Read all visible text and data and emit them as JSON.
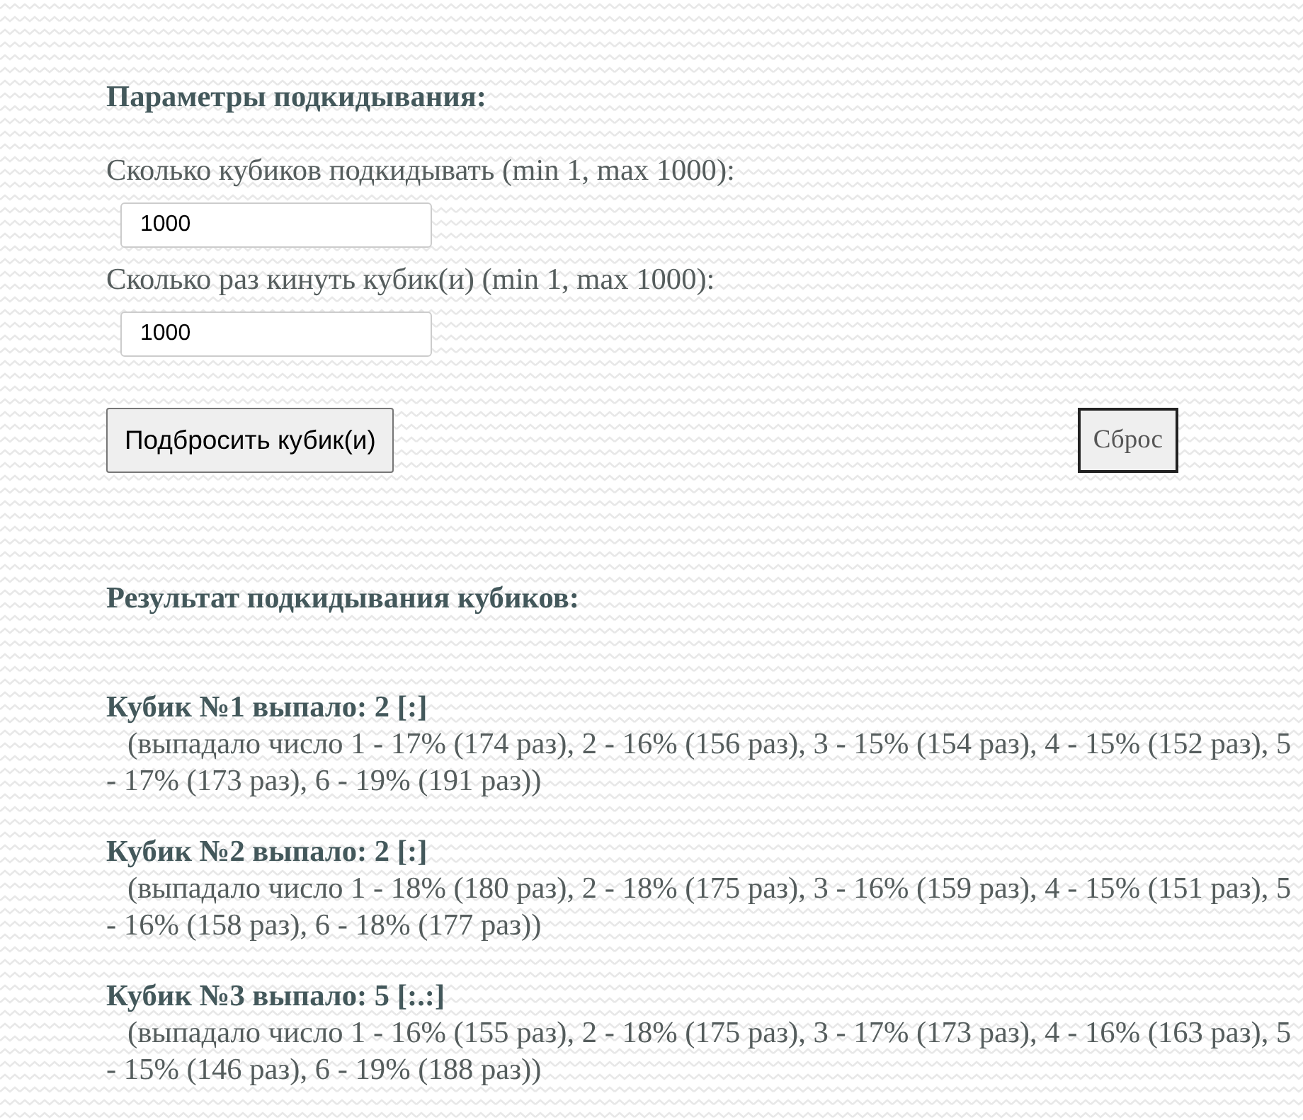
{
  "params": {
    "title": "Параметры подкидывания:",
    "fields": [
      {
        "label": "Сколько кубиков подкидывать (min 1, max 1000):",
        "value": "1000"
      },
      {
        "label": "Сколько раз кинуть кубик(и) (min 1, max 1000):",
        "value": "1000"
      }
    ],
    "buttons": [
      {
        "label": "Подбросить кубик(и)",
        "kind": "submit"
      },
      {
        "label": "Сброс",
        "kind": "reset"
      }
    ]
  },
  "results": {
    "title": "Результат подкидывания кубиков:",
    "dice": [
      {
        "title": "Кубик №1 выпало: 2 [:]",
        "stats": "(выпадало число 1 - 17% (174 раз), 2 - 16% (156 раз), 3 - 15% (154 раз), 4 - 15% (152 раз), 5 - 17% (173 раз), 6 - 19% (191 раз))"
      },
      {
        "title": "Кубик №2 выпало: 2 [:]",
        "stats": "(выпадало число 1 - 18% (180 раз), 2 - 18% (175 раз), 3 - 16% (159 раз), 4 - 15% (151 раз), 5 - 16% (158 раз), 6 - 18% (177 раз))"
      },
      {
        "title": "Кубик №3 выпало: 5 [:.:]",
        "stats": "(выпадало число 1 - 16% (155 раз), 2 - 18% (175 раз), 3 - 17% (173 раз), 4 - 16% (163 раз), 5 - 15% (146 раз), 6 - 19% (188 раз))"
      }
    ]
  }
}
